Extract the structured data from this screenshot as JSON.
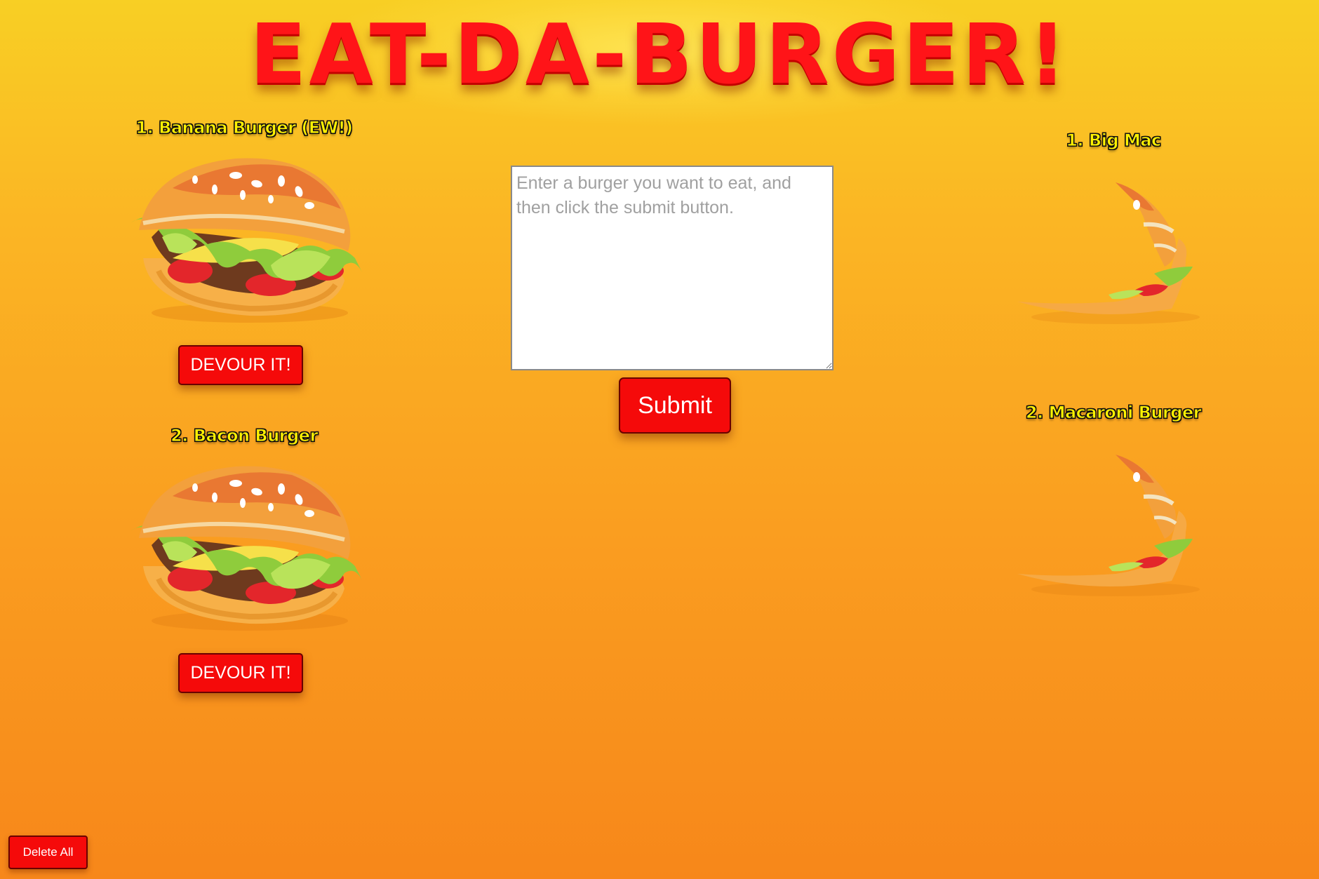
{
  "header": {
    "title": "EAT-DA-BURGER!"
  },
  "uneaten": {
    "items": [
      {
        "label": "1.  Banana Burger (EW!)",
        "button": "DEVOUR IT!",
        "icon": "burger-icon"
      },
      {
        "label": "2.  Bacon Burger",
        "button": "DEVOUR IT!",
        "icon": "burger-icon"
      }
    ]
  },
  "form": {
    "placeholder": "Enter a burger you want to eat, and then click the submit button.",
    "value": "",
    "submit_label": "Submit"
  },
  "devoured": {
    "items": [
      {
        "label": "1.  Big Mac",
        "icon": "eaten-burger-icon"
      },
      {
        "label": "2.  Macaroni Burger",
        "icon": "eaten-burger-icon"
      }
    ]
  },
  "footer": {
    "delete_label": "Delete All"
  },
  "colors": {
    "button_red": "#f50a0a",
    "label_yellow": "#fff200",
    "title_red": "#ff1418",
    "background_top": "#f8cf24",
    "background_bottom": "#f7871a"
  }
}
